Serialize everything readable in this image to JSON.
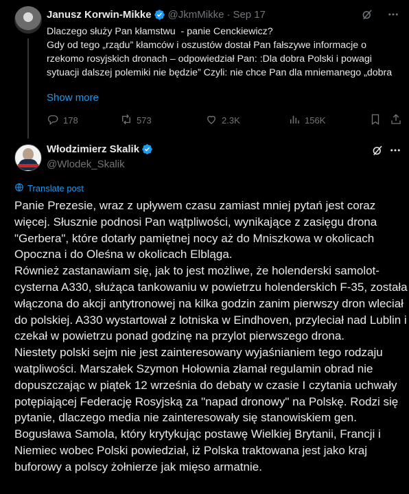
{
  "tweet1": {
    "author_name": "Janusz Korwin-Mikke",
    "handle": "@JkmMikke",
    "separator": "·",
    "date": "Sep 17",
    "text": "Dlaczego służy Pan kłamstwu  - panie Cenckiewicz?\nGdy od tego „rządu” kłamców i oszustów dostał Pan fałszywe informacje o rzekomo rosyjskich dronach – odpowiedział Pan: :Dla dobra Polski i powagi sytuacji dalszej polemiki nie będzie” Czyli: nie chce Pan dla mniemanego „dobra",
    "show_more": "Show more",
    "replies": "178",
    "reposts": "573",
    "likes": "2.3K",
    "views": "156K"
  },
  "tweet2": {
    "author_name": "Włodzimierz Skalik",
    "handle": "@Wlodek_Skalik",
    "translate": "Translate post",
    "paragraphs": [
      "Panie Prezesie, wraz z upływem czasu zamiast mniej pytań jest  coraz więcej. Słusznie podnosi Pan wątpliwości, wynikające z zasięgu drona \"Gerbera\", które dotarły pamiętnej nocy aż do Mniszkowa w okolicach Opoczna i do Oleśna w okolicach Elbląga.",
      "Również zastanawiam się, jak to jest możliwe, że holenderski samolot-cysterna A330, służąca tankowaniu w powietrzu holenderskich F-35, została włączona do akcji antytronowej na kilka godzin zanim pierwszy dron wleciał do polskiej. A330 wystartował z lotniska w Eindhoven, przyleciał nad Lublin i czekał w powietrzu ponad godzinę na przylot pierwszego drona.",
      "Niestety polski sejm nie jest zainteresowany wyjaśnianiem tego rodzaju watpliwości. Marszałek Szymon Hołownia złamał regulamin obrad nie dopuszczając w piątek 12 września do debaty w czasie I czytania uchwały potępiającej Federację Rosyjską za \"napad dronowy\" na Polskę. Rodzi się pytanie, dlaczego media nie zainteresowały się stanowiskiem gen. Bogusława Samola, który krytykując postawę Wielkiej Brytanii, Francji i Niemiec wobec Polski powiedział, iż Polska traktowana jest jako kraj buforowy a polscy żołnierze jak mięso armatnie."
    ]
  },
  "colors": {
    "background": "#000000",
    "text": "#e7e9ea",
    "muted": "#71767b",
    "accent": "#1d9bf0",
    "verified": "#1d9bf0"
  },
  "icons": [
    "verified-badge-icon",
    "grok-icon",
    "more-icon",
    "reply-icon",
    "repost-icon",
    "like-icon",
    "views-icon",
    "bookmark-icon",
    "share-icon",
    "translate-icon"
  ]
}
